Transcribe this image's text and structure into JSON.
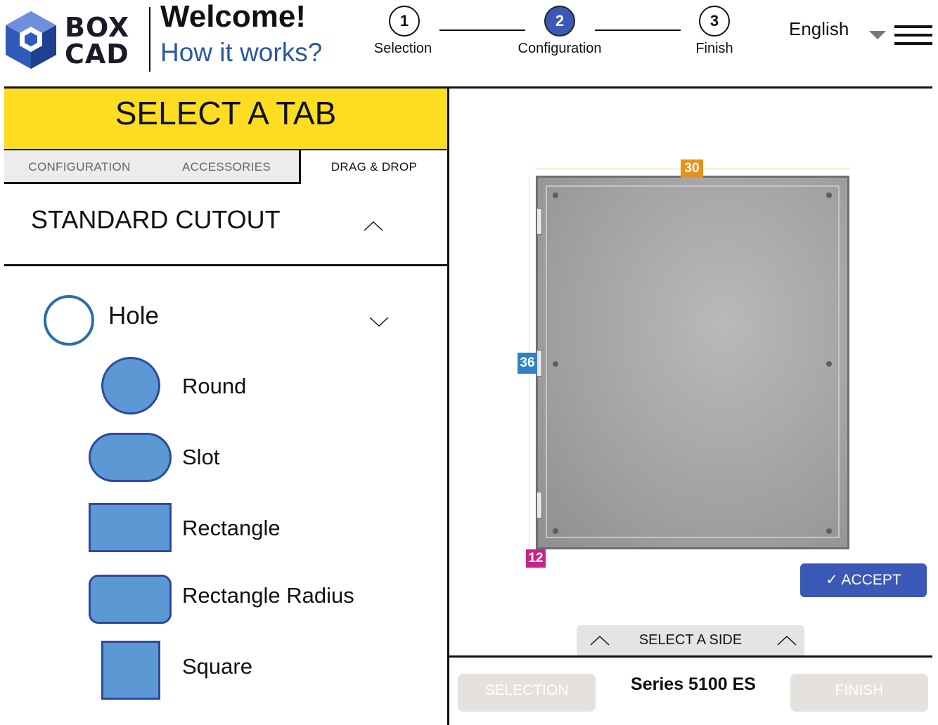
{
  "header": {
    "logo_top": "BOX",
    "logo_bottom": "CAD",
    "welcome": "Welcome!",
    "how_it_works": "How it works?",
    "steps": [
      {
        "number": "1",
        "label": "Selection",
        "active": false
      },
      {
        "number": "2",
        "label": "Configuration",
        "active": true
      },
      {
        "number": "3",
        "label": "Finish",
        "active": false
      }
    ],
    "language": "English"
  },
  "left_panel": {
    "title": "SELECT A TAB",
    "tabs": [
      {
        "label": "CONFIGURATION",
        "active": false
      },
      {
        "label": "ACCESSORIES",
        "active": false
      },
      {
        "label": "DRAG & DROP",
        "active": true
      }
    ],
    "section_title": "STANDARD CUTOUT",
    "group_title": "Hole",
    "shapes": [
      {
        "label": "Round",
        "icon": "round-shape-icon"
      },
      {
        "label": "Slot",
        "icon": "slot-shape-icon"
      },
      {
        "label": "Rectangle",
        "icon": "rectangle-shape-icon"
      },
      {
        "label": "Rectangle Radius",
        "icon": "rectangle-radius-shape-icon"
      },
      {
        "label": "Square",
        "icon": "square-shape-icon"
      }
    ]
  },
  "canvas": {
    "dimensions": {
      "width": "30",
      "height": "36",
      "depth": "12"
    },
    "accept_label": "✓ ACCEPT",
    "select_side_label": "SELECT A SIDE"
  },
  "footer": {
    "selection_label": "SELECTION",
    "series_label": "Series 5100 ES",
    "finish_label": "FINISH"
  },
  "colors": {
    "accent": "#3a59b6",
    "tab_header": "#fddd22",
    "shape_fill": "#5b98d4",
    "dim_width": "#e8901a",
    "dim_height": "#2f82c6",
    "dim_depth": "#c62585"
  }
}
